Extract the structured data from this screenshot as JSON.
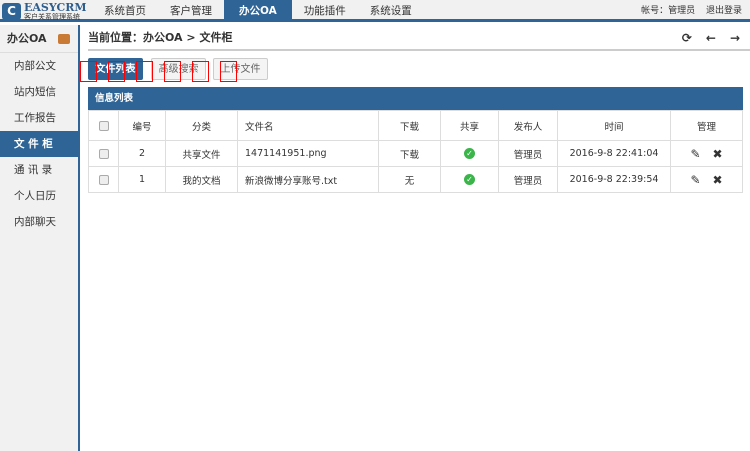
{
  "logo": {
    "brand": "EASYCRM",
    "subtitle": "客户关系管理系统"
  },
  "nav": [
    "系统首页",
    "客户管理",
    "办公OA",
    "功能插件",
    "系统设置"
  ],
  "account": {
    "user": "帐号：管理员",
    "logout": "退出登录"
  },
  "sidebar": {
    "title": "办公OA",
    "items": [
      "内部公文",
      "站内短信",
      "工作报告",
      "文 件 柜",
      "通 讯 录",
      "个人日历",
      "内部聊天"
    ]
  },
  "breadcrumb": "当前位置：办公OA > 文件柜",
  "toolbar": {
    "list": "文件列表",
    "search": "高级搜索",
    "upload": "上传文件"
  },
  "table": {
    "caption": "信息列表",
    "headers": [
      "编号",
      "分类",
      "文件名",
      "下载",
      "共享",
      "发布人",
      "时间",
      "管理"
    ],
    "rows": [
      {
        "id": "2",
        "category": "共享文件",
        "name": "1471141951.png",
        "download": "下载",
        "publisher": "管理员",
        "time": "2016-9-8 22:41:04"
      },
      {
        "id": "1",
        "category": "我的文档",
        "name": "新浪微博分享账号.txt",
        "download": "无",
        "publisher": "管理员",
        "time": "2016-9-8 22:39:54"
      }
    ]
  },
  "colors": {
    "primary": "#2f6496"
  }
}
